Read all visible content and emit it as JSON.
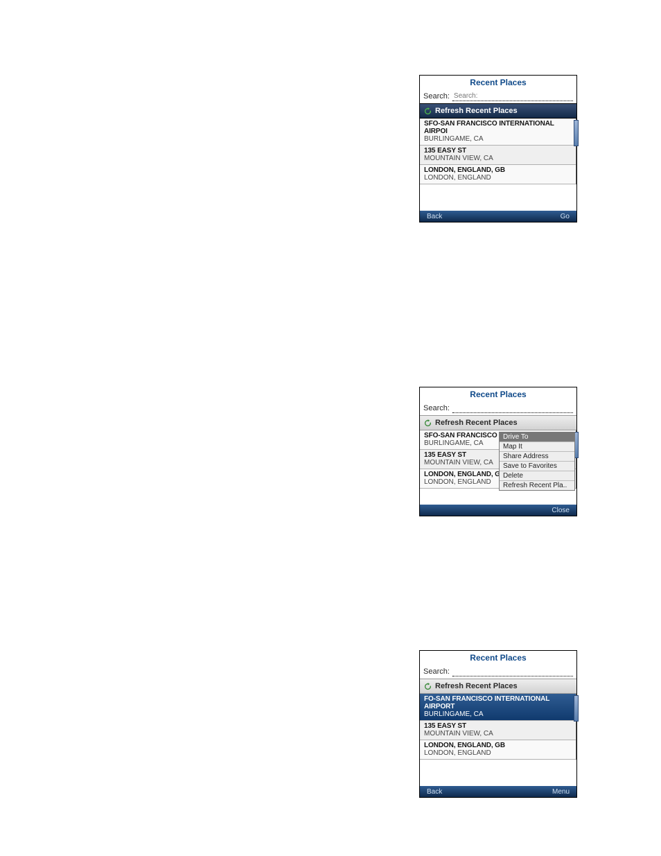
{
  "bullets_group1": [
    "",
    "",
    "",
    ""
  ],
  "bullets_group2": [
    "",
    "",
    "",
    ""
  ],
  "bullets_group3": [
    "",
    ""
  ],
  "phoneA": {
    "title": "Recent Places",
    "search_label": "Search:",
    "refresh_label": "Refresh Recent Places",
    "items": [
      {
        "line1": "SFO-SAN FRANCISCO INTERNATIONAL AIRPOI",
        "line2": "BURLINGAME, CA"
      },
      {
        "line1": "135 EASY ST",
        "line2": "MOUNTAIN VIEW, CA"
      },
      {
        "line1": "LONDON, ENGLAND, GB",
        "line2": "LONDON, ENGLAND"
      }
    ],
    "bottom_left": "Back",
    "bottom_right": "Go"
  },
  "phoneB": {
    "title": "Recent Places",
    "search_label": "Search:",
    "refresh_label": "Refresh Recent Places",
    "items": [
      {
        "line1": "SFO-SAN FRANCISCO IN",
        "line2": "BURLINGAME, CA"
      },
      {
        "line1": "135 EASY ST",
        "line2": "MOUNTAIN VIEW, CA"
      },
      {
        "line1": "LONDON, ENGLAND, GB",
        "line2": "LONDON, ENGLAND"
      }
    ],
    "popup": [
      "Drive To",
      "Map It",
      "Share Address",
      "Save to Favorites",
      "Delete",
      "Refresh Recent Pla.."
    ],
    "bottom_right": "Close"
  },
  "phoneC": {
    "title": "Recent Places",
    "search_label": "Search:",
    "refresh_label": "Refresh Recent Places",
    "items": [
      {
        "line1": "FO-SAN FRANCISCO INTERNATIONAL AIRPORT",
        "line2": "BURLINGAME, CA"
      },
      {
        "line1": "135 EASY ST",
        "line2": "MOUNTAIN VIEW, CA"
      },
      {
        "line1": "LONDON, ENGLAND, GB",
        "line2": "LONDON, ENGLAND"
      }
    ],
    "bottom_left": "Back",
    "bottom_right": "Menu"
  }
}
